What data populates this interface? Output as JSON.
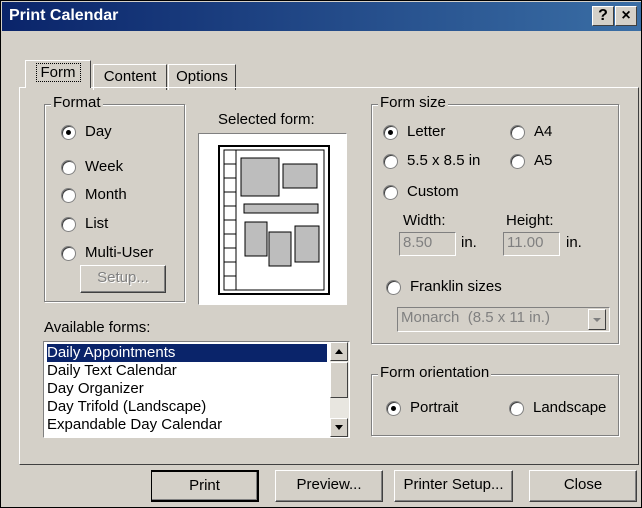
{
  "window": {
    "title": "Print Calendar",
    "help": "?",
    "close": "×"
  },
  "tabs": [
    "Form",
    "Content",
    "Options"
  ],
  "format": {
    "label": "Format",
    "options": [
      "Day",
      "Week",
      "Month",
      "List",
      "Multi-User"
    ],
    "selected": "Day",
    "setup_button": "Setup..."
  },
  "selected_form_label": "Selected form:",
  "form_size": {
    "label": "Form size",
    "options": [
      "Letter",
      "A4",
      "5.5 x 8.5 in",
      "A5",
      "Custom"
    ],
    "selected": "Letter",
    "width_label": "Width:",
    "height_label": "Height:",
    "width_value": "8.50",
    "height_value": "11.00",
    "unit": "in.",
    "franklin_label": "Franklin sizes",
    "franklin_value": "Monarch  (8.5 x 11 in.)"
  },
  "available_forms": {
    "label": "Available forms:",
    "items": [
      "Daily Appointments",
      "Daily Text Calendar",
      "Day Organizer",
      "Day Trifold (Landscape)",
      "Expandable Day Calendar"
    ],
    "selected": "Daily Appointments"
  },
  "orientation": {
    "label": "Form orientation",
    "options": [
      "Portrait",
      "Landscape"
    ],
    "selected": "Portrait"
  },
  "buttons": {
    "print": "Print",
    "preview": "Preview...",
    "printer_setup": "Printer Setup...",
    "close": "Close"
  },
  "colors": {
    "titlebar": "#0a246a",
    "face": "#d4d0c8",
    "selection": "#0a246a"
  }
}
